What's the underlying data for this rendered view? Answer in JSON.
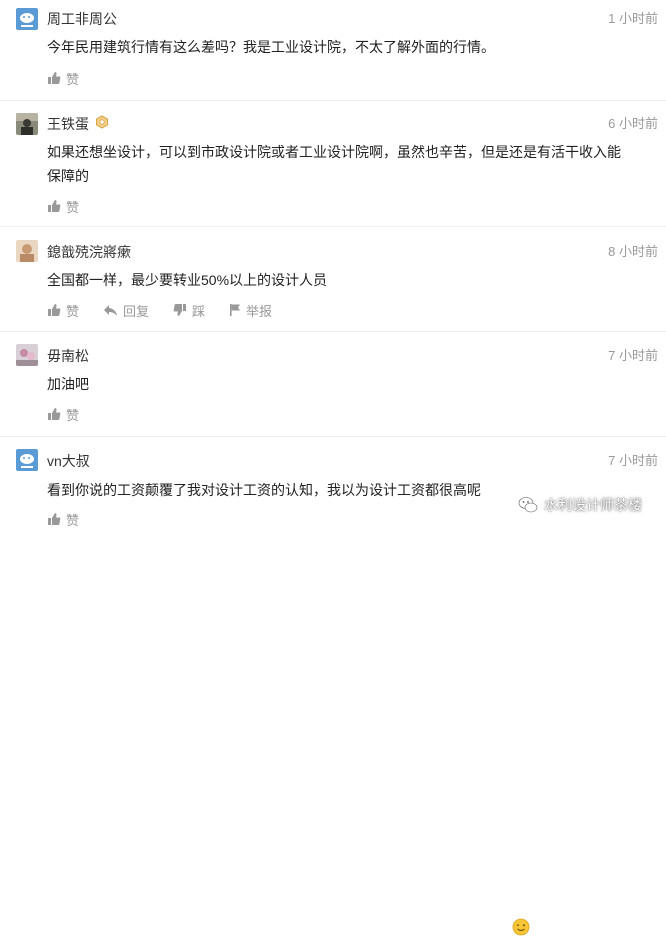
{
  "comments": [
    {
      "username": "周工非周公",
      "time": "1 小时前",
      "text": "今年民用建筑行情有这么差吗？我是工业设计院，不太了解外面的行情。",
      "like_label": "赞",
      "avatar_color": "#5b9bd5"
    },
    {
      "username": "王铁蛋",
      "time": "6 小时前",
      "text_line1": "如果还想坐设计，可以到市政设计院或者工业设计院啊，虽然也辛苦，但是还是有活干收入能",
      "text_line2": "保障的",
      "like_label": "赞",
      "badge_icon": "medal-icon"
    },
    {
      "username": "鎴戠殑浣嶈瘶",
      "time": "8 小时前",
      "text": "全国都一样，最少要转业50%以上的设计人员",
      "like_label": "赞",
      "reply_label": "回复",
      "dislike_label": "踩",
      "report_label": "举报"
    },
    {
      "username": "毋南松",
      "time": "7 小时前",
      "text": "加油吧",
      "like_label": "赞"
    },
    {
      "username": "vn大叔",
      "time": "7 小时前",
      "text": "看到你说的工资颠覆了我对设计工资的认知，我以为设计工资都很高呢",
      "like_label": "赞",
      "avatar_color": "#5b9bd5"
    }
  ],
  "watermark": {
    "label": "水利设计师茶楼",
    "icon": "wechat-icon"
  },
  "colors": {
    "meta_gray": "#999999",
    "text": "#222222",
    "divider": "#eeeeee"
  }
}
